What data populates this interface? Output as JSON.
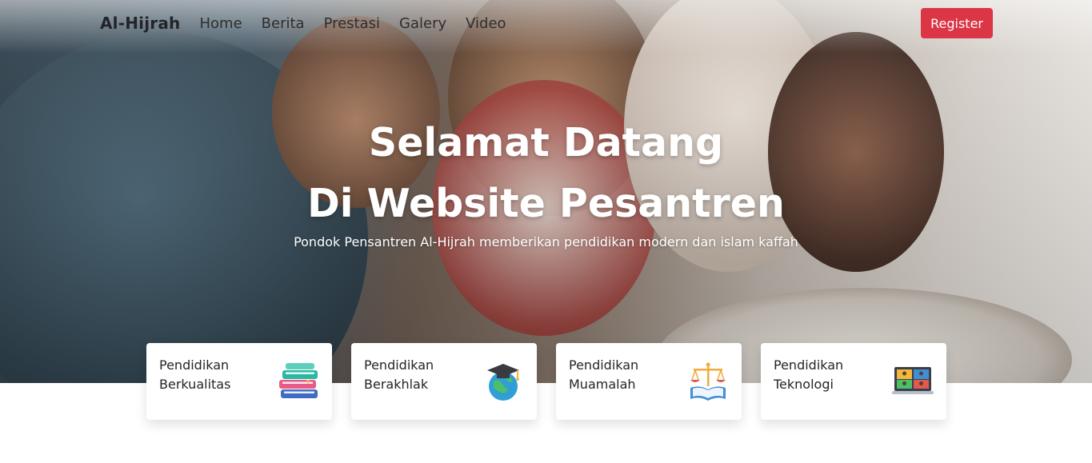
{
  "nav": {
    "brand": "Al-Hijrah",
    "links": [
      "Home",
      "Berita",
      "Prestasi",
      "Galery",
      "Video"
    ],
    "register_label": "Register"
  },
  "hero": {
    "title_line1": "Selamat Datang",
    "title_line2": "Di Website Pesantren",
    "subtitle": "Pondok Pensantren Al-Hijrah memberikan pendidikan modern dan islam kaffah",
    "background": "photo-children-reading-quran"
  },
  "features": [
    {
      "line1": "Pendidikan",
      "line2": "Berkualitas",
      "icon": "books-icon"
    },
    {
      "line1": "Pendidikan",
      "line2": "Berakhlak",
      "icon": "graduation-globe-icon"
    },
    {
      "line1": "Pendidikan",
      "line2": "Muamalah",
      "icon": "scales-book-icon"
    },
    {
      "line1": "Pendidikan",
      "line2": "Teknologi",
      "icon": "laptop-video-icon"
    }
  ],
  "colors": {
    "accent": "#dc3545",
    "text": "#212529",
    "hero_text": "#ffffff"
  }
}
